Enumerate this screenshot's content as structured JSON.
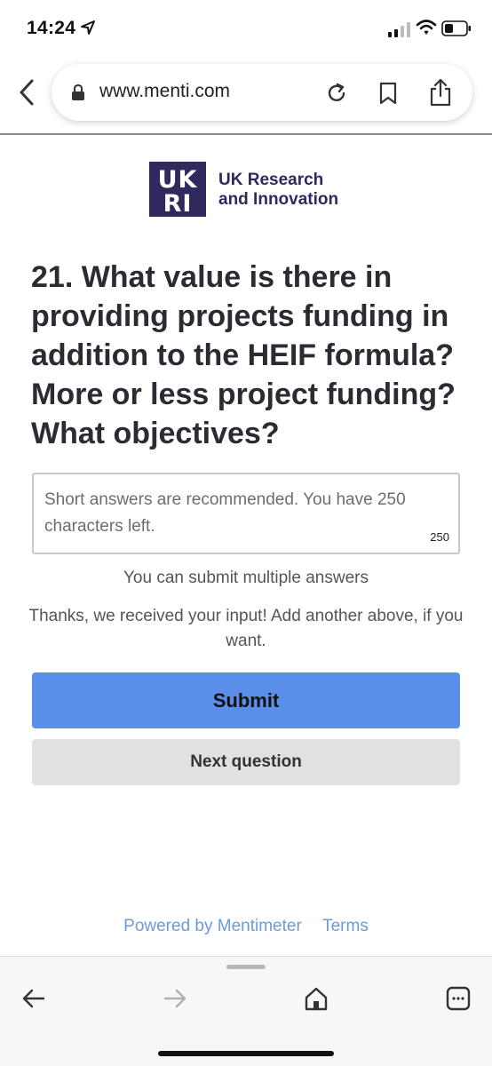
{
  "status_bar": {
    "time": "14:24",
    "location_icon": "location-arrow-icon",
    "signal_icon": "cell-signal-icon",
    "wifi_icon": "wifi-icon",
    "battery_icon": "battery-icon"
  },
  "browser": {
    "back_icon": "chevron-left-icon",
    "lock_icon": "lock-icon",
    "url": "www.menti.com",
    "reload_icon": "reload-icon",
    "bookmark_icon": "bookmark-icon",
    "share_icon": "share-icon"
  },
  "logo": {
    "mark_letters": "UKRI",
    "line1": "UK Research",
    "line2": "and Innovation",
    "brand_color": "#2e2a5e"
  },
  "question": {
    "text": "21. What value is there in providing projects funding in addition to the HEIF formula? More or less project funding? What objectives?"
  },
  "answer": {
    "placeholder": "Short answers are recommended. You have 250 characters left.",
    "char_count": "250"
  },
  "hints": {
    "multiple": "You can submit multiple answers",
    "thanks": "Thanks, we received your input! Add another above, if you want."
  },
  "buttons": {
    "submit": "Submit",
    "next": "Next question",
    "submit_color": "#5b8ee8"
  },
  "footer": {
    "powered_by": "Powered by Mentimeter",
    "terms": "Terms",
    "link_color": "#6e9ad8"
  },
  "bottom_bar": {
    "back_icon": "arrow-left-icon",
    "forward_icon": "arrow-right-icon",
    "home_icon": "home-icon",
    "tabs_icon": "tabs-icon"
  }
}
